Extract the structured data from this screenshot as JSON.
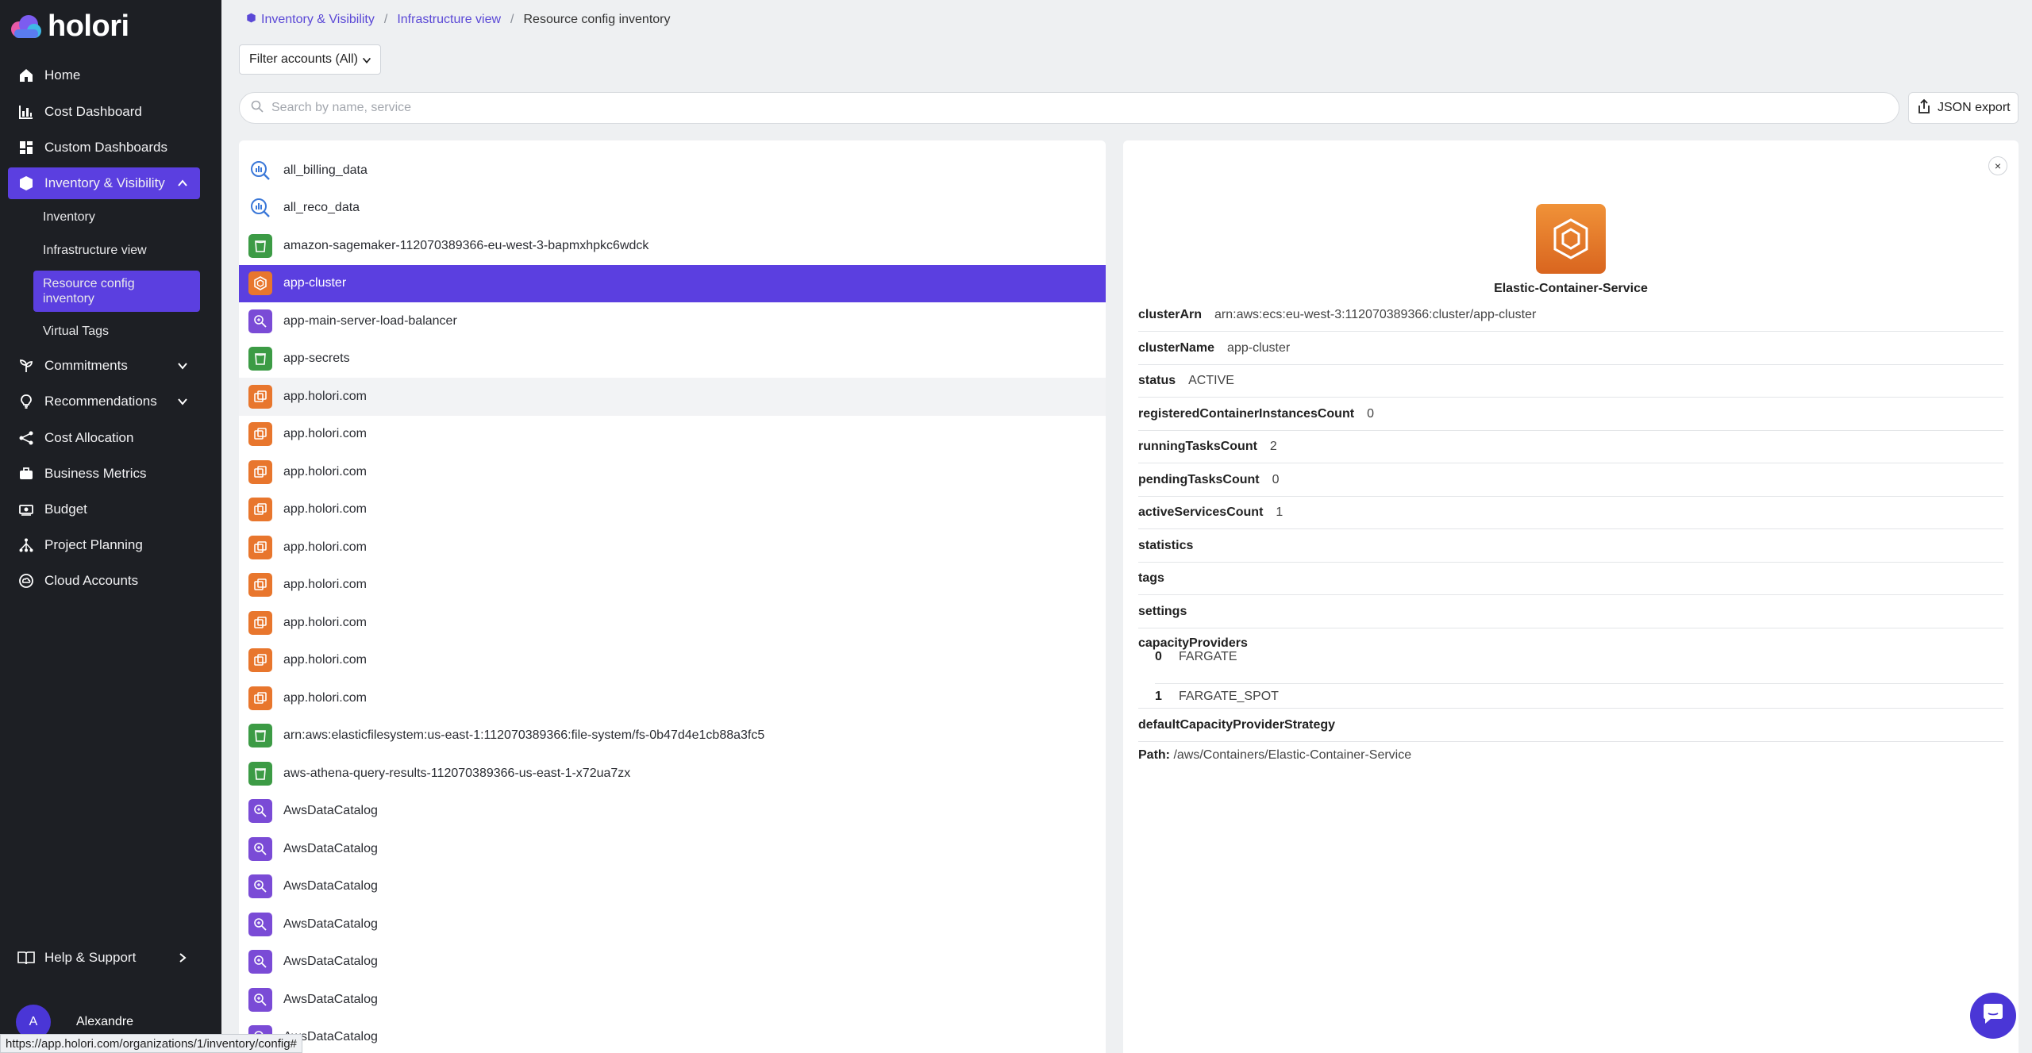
{
  "brand": {
    "name": "holori"
  },
  "nav": {
    "home": "Home",
    "cost_dashboard": "Cost Dashboard",
    "custom_dashboards": "Custom Dashboards",
    "inventory_visibility": "Inventory & Visibility",
    "sub": {
      "inventory": "Inventory",
      "infrastructure_view": "Infrastructure view",
      "resource_config_inventory": "Resource config inventory",
      "virtual_tags": "Virtual Tags"
    },
    "commitments": "Commitments",
    "recommendations": "Recommendations",
    "cost_allocation": "Cost Allocation",
    "business_metrics": "Business Metrics",
    "budget": "Budget",
    "project_planning": "Project Planning",
    "cloud_accounts": "Cloud Accounts",
    "help_support": "Help & Support"
  },
  "user": {
    "initial": "A",
    "name": "Alexandre"
  },
  "status_url": "https://app.holori.com/organizations/1/inventory/config#",
  "breadcrumb": {
    "item1": "Inventory & Visibility",
    "item2": "Infrastructure view",
    "item3": "Resource config inventory"
  },
  "filter": {
    "label": "Filter accounts (All)"
  },
  "search": {
    "placeholder": "Search by name, service",
    "value": ""
  },
  "export": {
    "label": "JSON export"
  },
  "list": [
    {
      "name": "all_billing_data",
      "icon": "blue"
    },
    {
      "name": "all_reco_data",
      "icon": "blue"
    },
    {
      "name": "amazon-sagemaker-112070389366-eu-west-3-bapmxhpkc6wdck",
      "icon": "green"
    },
    {
      "name": "app-cluster",
      "icon": "orange",
      "active": true
    },
    {
      "name": "app-main-server-load-balancer",
      "icon": "purple"
    },
    {
      "name": "app-secrets",
      "icon": "green"
    },
    {
      "name": "app.holori.com",
      "icon": "orange"
    },
    {
      "name": "app.holori.com",
      "icon": "orange"
    },
    {
      "name": "app.holori.com",
      "icon": "orange"
    },
    {
      "name": "app.holori.com",
      "icon": "orange"
    },
    {
      "name": "app.holori.com",
      "icon": "orange"
    },
    {
      "name": "app.holori.com",
      "icon": "orange"
    },
    {
      "name": "app.holori.com",
      "icon": "orange"
    },
    {
      "name": "app.holori.com",
      "icon": "orange"
    },
    {
      "name": "app.holori.com",
      "icon": "orange"
    },
    {
      "name": "arn:aws:elasticfilesystem:us-east-1:112070389366:file-system/fs-0b47d4e1cb88a3fc5",
      "icon": "green"
    },
    {
      "name": "aws-athena-query-results-112070389366-us-east-1-x72ua7zx",
      "icon": "green"
    },
    {
      "name": "AwsDataCatalog",
      "icon": "purple"
    },
    {
      "name": "AwsDataCatalog",
      "icon": "purple"
    },
    {
      "name": "AwsDataCatalog",
      "icon": "purple"
    },
    {
      "name": "AwsDataCatalog",
      "icon": "purple"
    },
    {
      "name": "AwsDataCatalog",
      "icon": "purple"
    },
    {
      "name": "AwsDataCatalog",
      "icon": "purple"
    },
    {
      "name": "AwsDataCatalog",
      "icon": "purple"
    }
  ],
  "detail": {
    "service_name": "Elastic-Container-Service",
    "fields": {
      "clusterArn": {
        "key": "clusterArn",
        "value": "arn:aws:ecs:eu-west-3:112070389366:cluster/app-cluster"
      },
      "clusterName": {
        "key": "clusterName",
        "value": "app-cluster"
      },
      "status": {
        "key": "status",
        "value": "ACTIVE"
      },
      "registered": {
        "key": "registeredContainerInstancesCount",
        "value": "0"
      },
      "running": {
        "key": "runningTasksCount",
        "value": "2"
      },
      "pending": {
        "key": "pendingTasksCount",
        "value": "0"
      },
      "active": {
        "key": "activeServicesCount",
        "value": "1"
      },
      "statistics": {
        "key": "statistics"
      },
      "tags": {
        "key": "tags"
      },
      "settings": {
        "key": "settings"
      },
      "capacityProviders": {
        "key": "capacityProviders"
      },
      "defaultStrategy": {
        "key": "defaultCapacityProviderStrategy"
      }
    },
    "capacity_providers": [
      {
        "idx": "0",
        "value": "FARGATE"
      },
      {
        "idx": "1",
        "value": "FARGATE_SPOT"
      }
    ],
    "path_label": "Path:",
    "path_value": "/aws/Containers/Elastic-Container-Service"
  },
  "colors": {
    "accent": "#5b3fe0",
    "sidebar": "#1d1f24",
    "orange": "#e8762d",
    "green": "#3c9b45",
    "purple": "#7a4bd6"
  }
}
